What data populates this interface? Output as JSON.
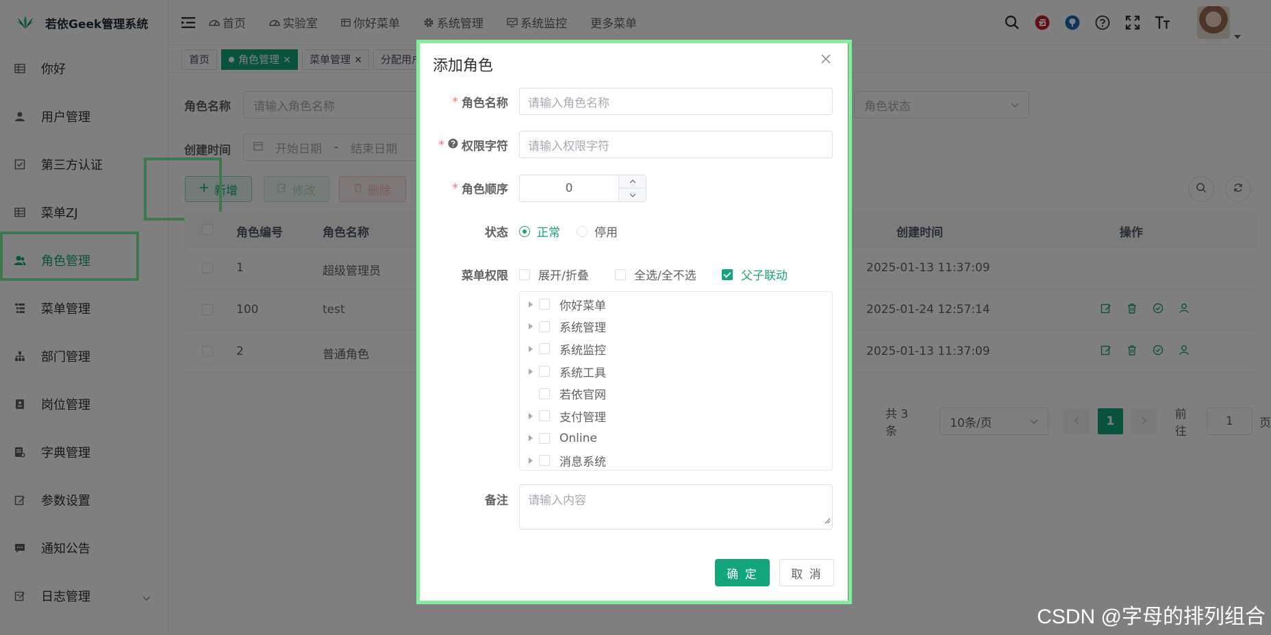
{
  "app": {
    "title": "若依Geek管理系统"
  },
  "sidebar": {
    "items": [
      {
        "label": "你好"
      },
      {
        "label": "用户管理"
      },
      {
        "label": "第三方认证"
      },
      {
        "label": "菜单ZJ"
      },
      {
        "label": "角色管理",
        "active": true
      },
      {
        "label": "菜单管理"
      },
      {
        "label": "部门管理"
      },
      {
        "label": "岗位管理"
      },
      {
        "label": "字典管理"
      },
      {
        "label": "参数设置"
      },
      {
        "label": "通知公告"
      },
      {
        "label": "日志管理"
      }
    ]
  },
  "navbar": {
    "menus": [
      {
        "label": "首页"
      },
      {
        "label": "实验室"
      },
      {
        "label": "你好菜单"
      },
      {
        "label": "系统管理"
      },
      {
        "label": "系统监控"
      },
      {
        "label": "更多菜单"
      }
    ]
  },
  "tags": [
    {
      "label": "首页"
    },
    {
      "label": "角色管理"
    },
    {
      "label": "菜单管理"
    },
    {
      "label": "分配用户"
    }
  ],
  "search": {
    "role_name_label": "角色名称",
    "role_name_placeholder": "请输入角色名称",
    "status_placeholder": "角色状态",
    "created_label": "创建时间",
    "start_placeholder": "开始日期",
    "range_sep": "-",
    "end_placeholder": "结束日期"
  },
  "toolbar": {
    "add": "新增",
    "edit": "修改",
    "delete": "删除"
  },
  "table": {
    "headers": {
      "id": "角色编号",
      "name": "角色名称",
      "created": "创建时间",
      "ops": "操作"
    },
    "rows": [
      {
        "id": "1",
        "name": "超级管理员",
        "created": "2025-01-13 11:37:09"
      },
      {
        "id": "100",
        "name": "test",
        "created": "2025-01-24 12:57:14"
      },
      {
        "id": "2",
        "name": "普通角色",
        "created": "2025-01-13 11:37:09"
      }
    ]
  },
  "pagination": {
    "total": "共 3 条",
    "page_size": "10条/页",
    "current": "1",
    "goto_label": "前往",
    "goto_value": "1",
    "page_suffix": "页"
  },
  "dialog": {
    "title": "添加角色",
    "role_name_label": "角色名称",
    "role_name_placeholder": "请输入角色名称",
    "perm_label": "权限字符",
    "perm_placeholder": "请输入权限字符",
    "order_label": "角色顺序",
    "order_value": "0",
    "status_label": "状态",
    "status_options": [
      {
        "label": "正常",
        "checked": true
      },
      {
        "label": "停用",
        "checked": false
      }
    ],
    "menu_perm_label": "菜单权限",
    "menu_checks": [
      {
        "label": "展开/折叠",
        "checked": false
      },
      {
        "label": "全选/全不选",
        "checked": false
      },
      {
        "label": "父子联动",
        "checked": true
      }
    ],
    "tree": [
      {
        "label": "你好菜单",
        "expandable": true
      },
      {
        "label": "系统管理",
        "expandable": true
      },
      {
        "label": "系统监控",
        "expandable": true
      },
      {
        "label": "系统工具",
        "expandable": true
      },
      {
        "label": "若依官网",
        "expandable": false
      },
      {
        "label": "支付管理",
        "expandable": true
      },
      {
        "label": "Online",
        "expandable": true
      },
      {
        "label": "消息系统",
        "expandable": true
      }
    ],
    "remark_label": "备注",
    "remark_placeholder": "请输入内容",
    "confirm": "确 定",
    "cancel": "取 消"
  },
  "watermark": "CSDN @字母的排列组合",
  "colors": {
    "primary": "#13a57c",
    "highlight": "#7ff09a",
    "danger": "#f56c6c"
  }
}
